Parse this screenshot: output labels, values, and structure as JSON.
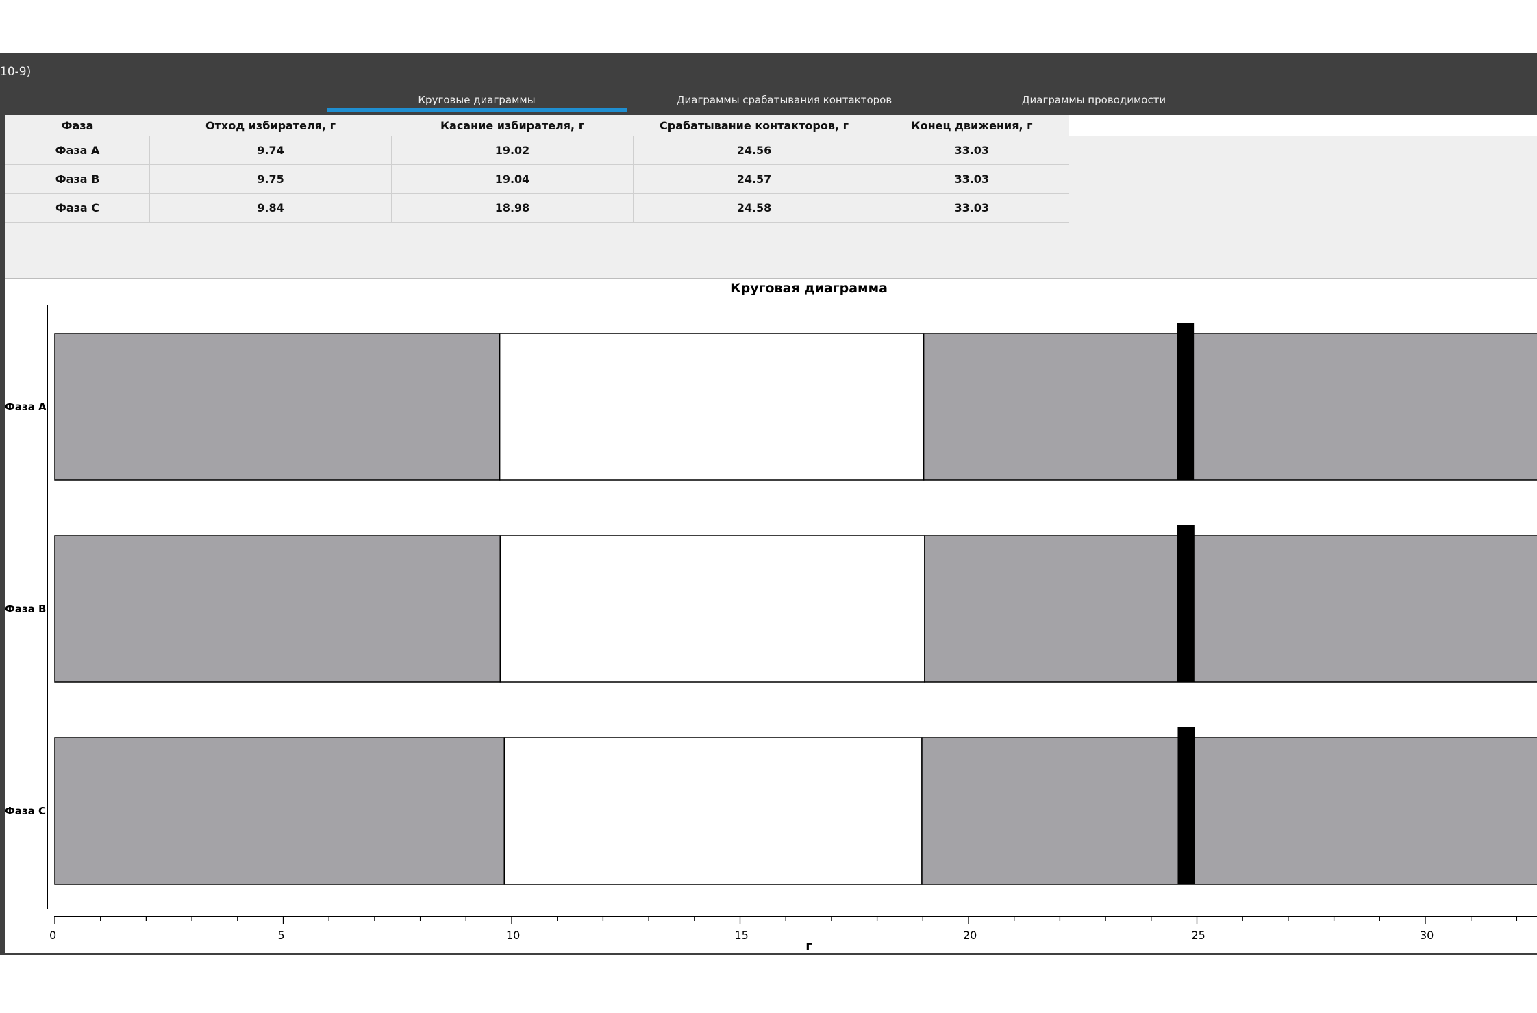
{
  "window": {
    "title": "10-9)"
  },
  "tabs": [
    {
      "label": "Круговые диаграммы",
      "active": true
    },
    {
      "label": "Диаграммы срабатывания контакторов",
      "active": false
    },
    {
      "label": "Диаграммы проводимости",
      "active": false
    }
  ],
  "colors": {
    "accent": "#1f8fd1",
    "frame": "#404040",
    "bar_fill": "#a4a3a7",
    "marker": "#000000"
  },
  "table": {
    "headers": [
      "Фаза",
      "Отход избирателя, г",
      "Касание избирателя, г",
      "Срабатывание контакторов, г",
      "Конец движения, г"
    ],
    "rows": [
      [
        "Фаза A",
        "9.74",
        "19.02",
        "24.56",
        "33.03"
      ],
      [
        "Фаза B",
        "9.75",
        "19.04",
        "24.57",
        "33.03"
      ],
      [
        "Фаза C",
        "9.84",
        "18.98",
        "24.58",
        "33.03"
      ]
    ]
  },
  "chart_data": {
    "type": "bar",
    "title": "Круговая диаграмма",
    "xlabel": "г",
    "ylabel": "",
    "xlim": [
      0,
      32.5
    ],
    "xticks": [
      0,
      5,
      10,
      15,
      20,
      25,
      30
    ],
    "categories": [
      "Фаза A",
      "Фаза B",
      "Фаза C"
    ],
    "series": [
      {
        "phase": "Фаза A",
        "release": 9.74,
        "touch": 19.02,
        "contactor": 24.56,
        "end": 33.03
      },
      {
        "phase": "Фаза B",
        "release": 9.75,
        "touch": 19.04,
        "contactor": 24.57,
        "end": 33.03
      },
      {
        "phase": "Фаза C",
        "release": 9.84,
        "touch": 18.98,
        "contactor": 24.58,
        "end": 33.03
      }
    ]
  }
}
